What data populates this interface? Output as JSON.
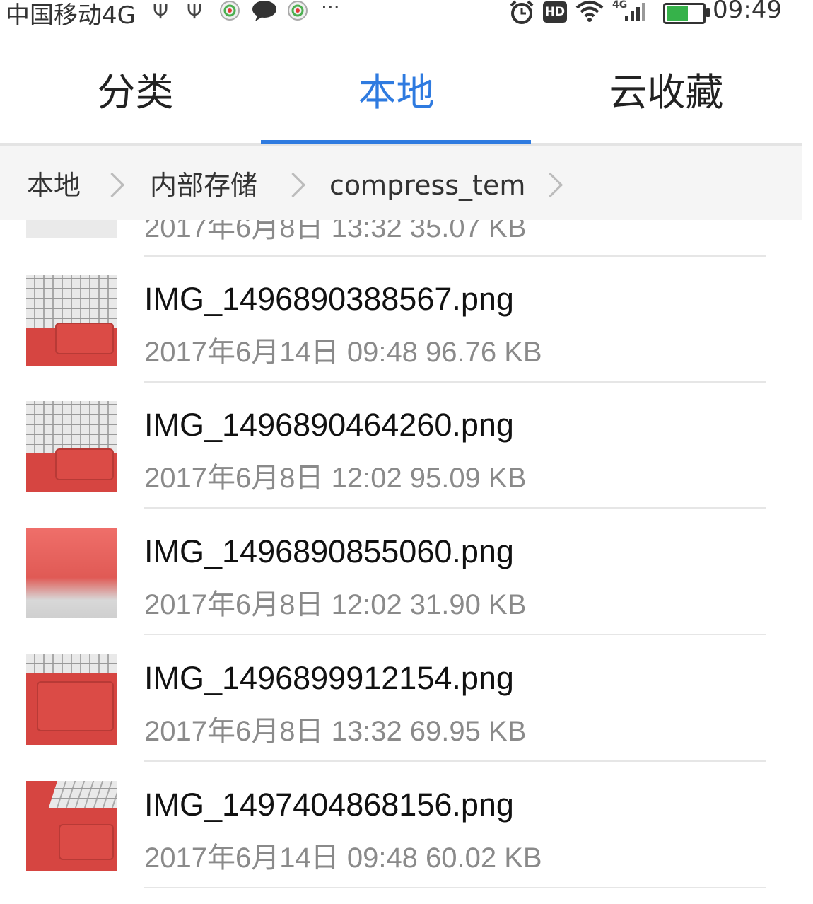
{
  "status_bar": {
    "carrier": "中国移动4G",
    "time": "09:49",
    "hd": "HD",
    "net": "4G",
    "icons": [
      "usb-icon",
      "usb-icon",
      "app-icon",
      "message-icon",
      "app-icon",
      "more-icon",
      "alarm-icon",
      "wifi-icon",
      "signal-icon",
      "battery-icon"
    ]
  },
  "tabs": [
    {
      "label": "分类"
    },
    {
      "label": "本地"
    },
    {
      "label": "云收藏"
    }
  ],
  "active_tab": "本地",
  "accent_color": "#2f7be0",
  "breadcrumb": [
    {
      "label": "本地"
    },
    {
      "label": "内部存储"
    },
    {
      "label": "compress_tem"
    }
  ],
  "partial_row": {
    "meta": "2017年6月8日 13:32 35.07 KB"
  },
  "files": [
    {
      "name": "IMG_1496890388567.png",
      "meta": "2017年6月14日 09:48 96.76 KB"
    },
    {
      "name": "IMG_1496890464260.png",
      "meta": "2017年6月8日 12:02 95.09 KB"
    },
    {
      "name": "IMG_1496890855060.png",
      "meta": "2017年6月8日 12:02 31.90 KB"
    },
    {
      "name": "IMG_1496899912154.png",
      "meta": "2017年6月8日 13:32 69.95 KB"
    },
    {
      "name": "IMG_1497404868156.png",
      "meta": "2017年6月14日 09:48 60.02 KB"
    }
  ]
}
